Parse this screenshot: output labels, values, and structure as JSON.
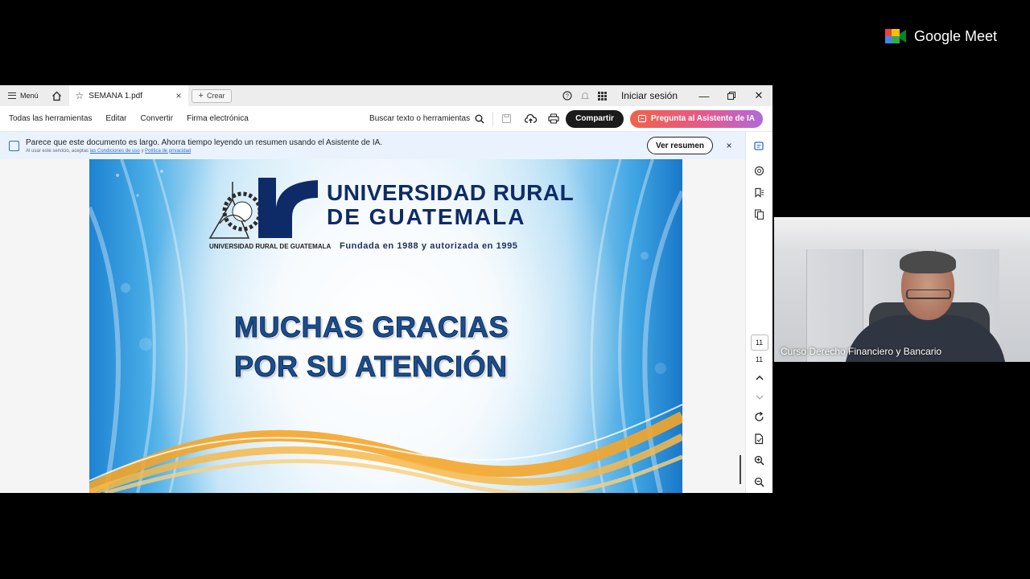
{
  "tabbar": {
    "menu_label": "Menú",
    "tab_title": "SEMANA 1.pdf",
    "tab_close": "×",
    "create_label": "Crear",
    "signin_label": "Iniciar sesión"
  },
  "toolbar": {
    "all_tools": "Todas las herramientas",
    "edit": "Editar",
    "convert": "Convertir",
    "esign": "Firma electrónica",
    "search_tools": "Buscar texto o herramientas",
    "share_label": "Compartir",
    "ai_label": "Pregunta al Asistente de IA"
  },
  "banner": {
    "message": "Parece que este documento es largo. Ahorra tiempo leyendo un resumen usando el Asistente de IA.",
    "sub_prefix": "Al usar este servicio, aceptas",
    "terms_link": "las Condiciones de uso",
    "sub_and": "y",
    "privacy_link": "Política de privacidad",
    "summary_button": "Ver resumen",
    "close": "×"
  },
  "slide": {
    "university_line1": "UNIVERSIDAD RURAL",
    "university_line2": "DE GUATEMALA",
    "logo_caption": "UNIVERSIDAD RURAL DE GUATEMALA",
    "founded": "Fundada en 1988 y autorizada en 1995",
    "thanks_line1": "MUCHAS GRACIAS",
    "thanks_line2": "POR SU ATENCIÓN"
  },
  "rail": {
    "current_page": "11",
    "total_pages": "11"
  },
  "meet": {
    "brand": "Google Meet",
    "participant_name": "Curso Derecho Financiero y Bancario"
  },
  "colors": {
    "navy_text": "#0f2b67",
    "accent_blue": "#2f6bd1",
    "share_button": "#1b1b1b",
    "banner_bg": "#eaf3fd"
  }
}
